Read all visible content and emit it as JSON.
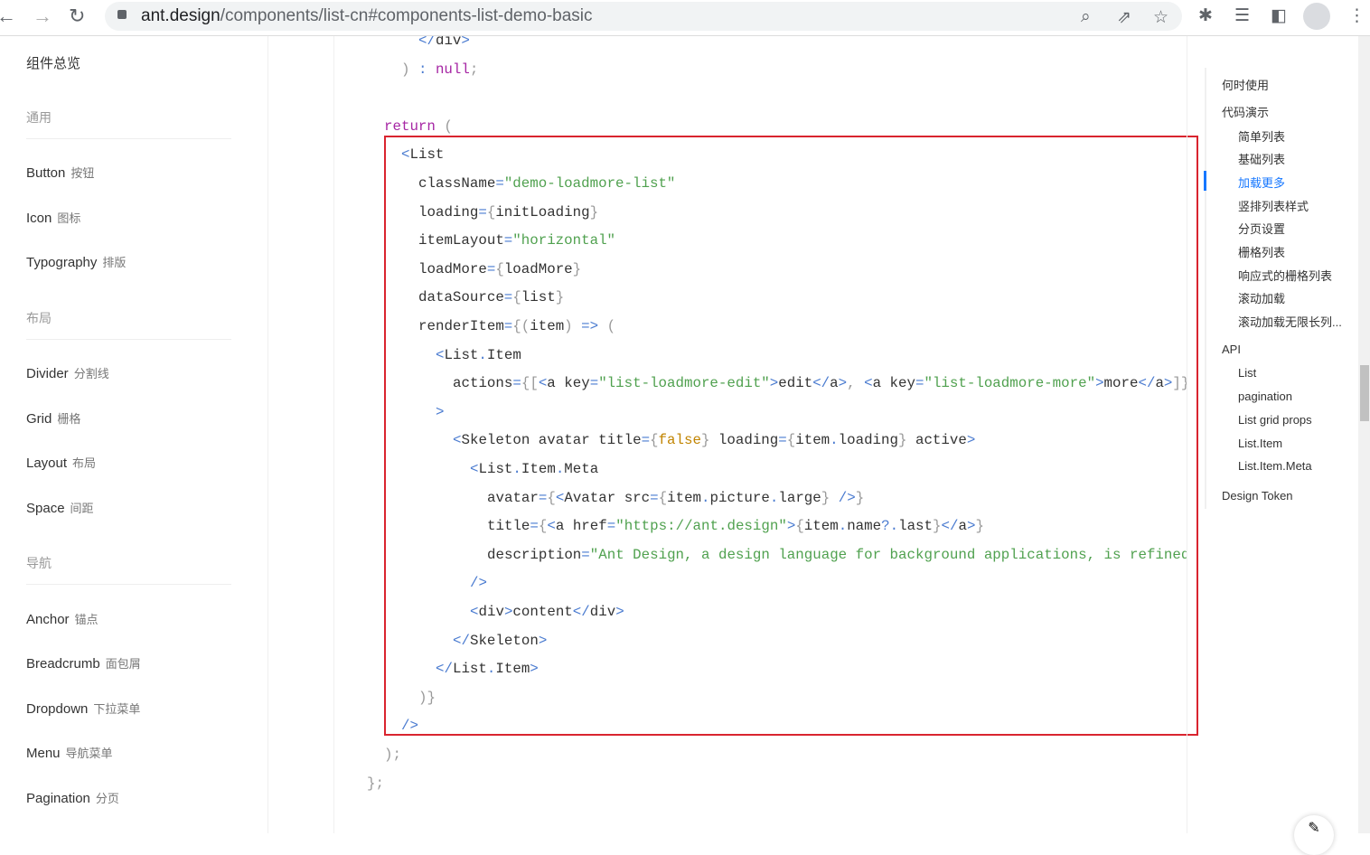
{
  "browser": {
    "url_host": "ant.design",
    "url_path": "/components/list-cn#components-list-demo-basic",
    "icons": [
      "back-icon",
      "forward-icon",
      "reload-icon",
      "lock-icon",
      "zoom-icon",
      "share-icon",
      "star-icon",
      "extensions-icon",
      "reading-list-icon",
      "side-panel-icon",
      "profile-icon",
      "menu-icon"
    ]
  },
  "sidebar": {
    "overview": "组件总览",
    "entries": [
      {
        "type": "group",
        "label": "通用"
      },
      {
        "type": "item",
        "label": "Button",
        "cn": "按钮"
      },
      {
        "type": "item",
        "label": "Icon",
        "cn": "图标"
      },
      {
        "type": "item",
        "label": "Typography",
        "cn": "排版"
      },
      {
        "type": "group",
        "label": "布局"
      },
      {
        "type": "item",
        "label": "Divider",
        "cn": "分割线"
      },
      {
        "type": "item",
        "label": "Grid",
        "cn": "栅格"
      },
      {
        "type": "item",
        "label": "Layout",
        "cn": "布局"
      },
      {
        "type": "item",
        "label": "Space",
        "cn": "间距"
      },
      {
        "type": "group",
        "label": "导航"
      },
      {
        "type": "item",
        "label": "Anchor",
        "cn": "锚点"
      },
      {
        "type": "item",
        "label": "Breadcrumb",
        "cn": "面包屑"
      },
      {
        "type": "item",
        "label": "Dropdown",
        "cn": "下拉菜单"
      },
      {
        "type": "item",
        "label": "Menu",
        "cn": "导航菜单"
      },
      {
        "type": "item",
        "label": "Pagination",
        "cn": "分页"
      }
    ]
  },
  "colors": {
    "tag": "#4a7bd0",
    "attr": "#333333",
    "str": "#50a14f",
    "kw": "#a626a4",
    "brace": "#999999",
    "bool": "#c18401",
    "plain": "#333333",
    "highlight": "#d9242f",
    "accent": "#1677ff"
  },
  "code": [
    {
      "indent": 3,
      "tokens": [
        [
          "tag",
          "</"
        ],
        [
          "plain",
          "div"
        ],
        [
          "tag",
          ">"
        ]
      ]
    },
    {
      "indent": 2,
      "tokens": [
        [
          "brace",
          ") "
        ],
        [
          "tag",
          ": "
        ],
        [
          "kw",
          "null"
        ],
        [
          "brace",
          ";"
        ]
      ]
    },
    {
      "indent": 0,
      "tokens": []
    },
    {
      "indent": 1,
      "tokens": [
        [
          "kw",
          "return"
        ],
        [
          "brace",
          " ("
        ]
      ]
    },
    {
      "indent": 2,
      "tokens": [
        [
          "tag",
          "<"
        ],
        [
          "plain",
          "List"
        ]
      ]
    },
    {
      "indent": 3,
      "tokens": [
        [
          "attr",
          "className"
        ],
        [
          "tag",
          "="
        ],
        [
          "str",
          "\"demo-loadmore-list\""
        ]
      ]
    },
    {
      "indent": 3,
      "tokens": [
        [
          "attr",
          "loading"
        ],
        [
          "tag",
          "="
        ],
        [
          "brace",
          "{"
        ],
        [
          "plain",
          "initLoading"
        ],
        [
          "brace",
          "}"
        ]
      ]
    },
    {
      "indent": 3,
      "tokens": [
        [
          "attr",
          "itemLayout"
        ],
        [
          "tag",
          "="
        ],
        [
          "str",
          "\"horizontal\""
        ]
      ]
    },
    {
      "indent": 3,
      "tokens": [
        [
          "attr",
          "loadMore"
        ],
        [
          "tag",
          "="
        ],
        [
          "brace",
          "{"
        ],
        [
          "plain",
          "loadMore"
        ],
        [
          "brace",
          "}"
        ]
      ]
    },
    {
      "indent": 3,
      "tokens": [
        [
          "attr",
          "dataSource"
        ],
        [
          "tag",
          "="
        ],
        [
          "brace",
          "{"
        ],
        [
          "plain",
          "list"
        ],
        [
          "brace",
          "}"
        ]
      ]
    },
    {
      "indent": 3,
      "tokens": [
        [
          "attr",
          "renderItem"
        ],
        [
          "tag",
          "="
        ],
        [
          "brace",
          "{("
        ],
        [
          "plain",
          "item"
        ],
        [
          "brace",
          ") "
        ],
        [
          "tag",
          "=>"
        ],
        [
          "brace",
          " ("
        ]
      ]
    },
    {
      "indent": 4,
      "tokens": [
        [
          "tag",
          "<"
        ],
        [
          "plain",
          "List"
        ],
        [
          "tag",
          "."
        ],
        [
          "plain",
          "Item"
        ]
      ]
    },
    {
      "indent": 5,
      "tokens": [
        [
          "attr",
          "actions"
        ],
        [
          "tag",
          "="
        ],
        [
          "brace",
          "{["
        ],
        [
          "tag",
          "<"
        ],
        [
          "plain",
          "a key"
        ],
        [
          "tag",
          "="
        ],
        [
          "str",
          "\"list-loadmore-edit\""
        ],
        [
          "tag",
          ">"
        ],
        [
          "plain",
          "edit"
        ],
        [
          "tag",
          "</"
        ],
        [
          "plain",
          "a"
        ],
        [
          "tag",
          ">"
        ],
        [
          "brace",
          ", "
        ],
        [
          "tag",
          "<"
        ],
        [
          "plain",
          "a key"
        ],
        [
          "tag",
          "="
        ],
        [
          "str",
          "\"list-loadmore-more\""
        ],
        [
          "tag",
          ">"
        ],
        [
          "plain",
          "more"
        ],
        [
          "tag",
          "</"
        ],
        [
          "plain",
          "a"
        ],
        [
          "tag",
          ">"
        ],
        [
          "brace",
          "]}"
        ]
      ]
    },
    {
      "indent": 4,
      "tokens": [
        [
          "tag",
          ">"
        ]
      ]
    },
    {
      "indent": 5,
      "tokens": [
        [
          "tag",
          "<"
        ],
        [
          "plain",
          "Skeleton avatar title"
        ],
        [
          "tag",
          "="
        ],
        [
          "brace",
          "{"
        ],
        [
          "bool",
          "false"
        ],
        [
          "brace",
          "}"
        ],
        [
          "plain",
          " loading"
        ],
        [
          "tag",
          "="
        ],
        [
          "brace",
          "{"
        ],
        [
          "plain",
          "item"
        ],
        [
          "tag",
          "."
        ],
        [
          "plain",
          "loading"
        ],
        [
          "brace",
          "}"
        ],
        [
          "plain",
          " active"
        ],
        [
          "tag",
          ">"
        ]
      ]
    },
    {
      "indent": 6,
      "tokens": [
        [
          "tag",
          "<"
        ],
        [
          "plain",
          "List"
        ],
        [
          "tag",
          "."
        ],
        [
          "plain",
          "Item"
        ],
        [
          "tag",
          "."
        ],
        [
          "plain",
          "Meta"
        ]
      ]
    },
    {
      "indent": 7,
      "tokens": [
        [
          "attr",
          "avatar"
        ],
        [
          "tag",
          "="
        ],
        [
          "brace",
          "{"
        ],
        [
          "tag",
          "<"
        ],
        [
          "plain",
          "Avatar src"
        ],
        [
          "tag",
          "="
        ],
        [
          "brace",
          "{"
        ],
        [
          "plain",
          "item"
        ],
        [
          "tag",
          "."
        ],
        [
          "plain",
          "picture"
        ],
        [
          "tag",
          "."
        ],
        [
          "plain",
          "large"
        ],
        [
          "brace",
          "} "
        ],
        [
          "tag",
          "/>"
        ],
        [
          "brace",
          "}"
        ]
      ]
    },
    {
      "indent": 7,
      "tokens": [
        [
          "attr",
          "title"
        ],
        [
          "tag",
          "="
        ],
        [
          "brace",
          "{"
        ],
        [
          "tag",
          "<"
        ],
        [
          "plain",
          "a href"
        ],
        [
          "tag",
          "="
        ],
        [
          "str",
          "\"https://ant.design\""
        ],
        [
          "tag",
          ">"
        ],
        [
          "brace",
          "{"
        ],
        [
          "plain",
          "item"
        ],
        [
          "tag",
          "."
        ],
        [
          "plain",
          "name"
        ],
        [
          "tag",
          "?."
        ],
        [
          "plain",
          "last"
        ],
        [
          "brace",
          "}"
        ],
        [
          "tag",
          "</"
        ],
        [
          "plain",
          "a"
        ],
        [
          "tag",
          ">"
        ],
        [
          "brace",
          "}"
        ]
      ]
    },
    {
      "indent": 7,
      "tokens": [
        [
          "attr",
          "description"
        ],
        [
          "tag",
          "="
        ],
        [
          "str",
          "\"Ant Design, a design language for background applications, is refined by Ant UED Team\""
        ]
      ]
    },
    {
      "indent": 6,
      "tokens": [
        [
          "tag",
          "/>"
        ]
      ]
    },
    {
      "indent": 6,
      "tokens": [
        [
          "tag",
          "<"
        ],
        [
          "plain",
          "div"
        ],
        [
          "tag",
          ">"
        ],
        [
          "plain",
          "content"
        ],
        [
          "tag",
          "</"
        ],
        [
          "plain",
          "div"
        ],
        [
          "tag",
          ">"
        ]
      ]
    },
    {
      "indent": 5,
      "tokens": [
        [
          "tag",
          "</"
        ],
        [
          "plain",
          "Skeleton"
        ],
        [
          "tag",
          ">"
        ]
      ]
    },
    {
      "indent": 4,
      "tokens": [
        [
          "tag",
          "</"
        ],
        [
          "plain",
          "List"
        ],
        [
          "tag",
          "."
        ],
        [
          "plain",
          "Item"
        ],
        [
          "tag",
          ">"
        ]
      ]
    },
    {
      "indent": 3,
      "tokens": [
        [
          "brace",
          ")}"
        ]
      ]
    },
    {
      "indent": 2,
      "tokens": [
        [
          "tag",
          "/>"
        ]
      ]
    },
    {
      "indent": 1,
      "tokens": [
        [
          "brace",
          ");"
        ]
      ]
    },
    {
      "indent": 0,
      "tokens": [
        [
          "brace",
          "};"
        ]
      ]
    }
  ],
  "anchor": [
    {
      "label": "何时使用",
      "level": 1
    },
    {
      "label": "代码演示",
      "level": 1
    },
    {
      "label": "简单列表",
      "level": 2
    },
    {
      "label": "基础列表",
      "level": 2
    },
    {
      "label": "加载更多",
      "level": 2,
      "active": true
    },
    {
      "label": "竖排列表样式",
      "level": 2
    },
    {
      "label": "分页设置",
      "level": 2
    },
    {
      "label": "栅格列表",
      "level": 2
    },
    {
      "label": "响应式的栅格列表",
      "level": 2
    },
    {
      "label": "滚动加载",
      "level": 2
    },
    {
      "label": "滚动加载无限长列...",
      "level": 2
    },
    {
      "label": "API",
      "level": 1
    },
    {
      "label": "List",
      "level": 2
    },
    {
      "label": "pagination",
      "level": 2
    },
    {
      "label": "List grid props",
      "level": 2
    },
    {
      "label": "List.Item",
      "level": 2
    },
    {
      "label": "List.Item.Meta",
      "level": 2
    },
    {
      "label": "Design Token",
      "level": 1
    }
  ]
}
